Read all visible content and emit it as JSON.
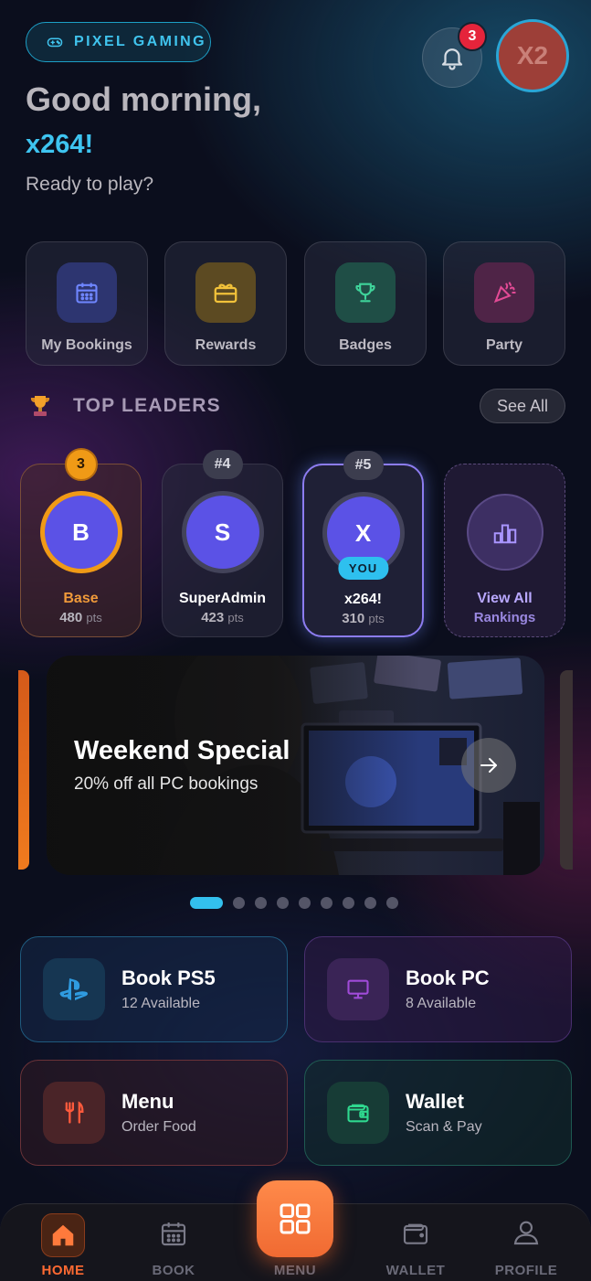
{
  "brand": {
    "label": "PIXEL GAMING",
    "accent": "#3ec4f0"
  },
  "header": {
    "notifications_count": "3",
    "avatar_initials": "X2"
  },
  "greeting": {
    "line": "Good morning,",
    "username": "x264!",
    "subtitle": "Ready to play?"
  },
  "quick_actions": [
    {
      "label": "My Bookings",
      "icon": "calendar-icon"
    },
    {
      "label": "Rewards",
      "icon": "gift-card-icon"
    },
    {
      "label": "Badges",
      "icon": "trophy-icon"
    },
    {
      "label": "Party",
      "icon": "party-popper-icon"
    }
  ],
  "leaders": {
    "title": "TOP LEADERS",
    "see_all": "See All",
    "cards": [
      {
        "rank": "3",
        "initial": "B",
        "name": "Base",
        "points": "480",
        "unit": "pts"
      },
      {
        "rank": "#4",
        "initial": "S",
        "name": "SuperAdmin",
        "points": "423",
        "unit": "pts"
      },
      {
        "rank": "#5",
        "initial": "X",
        "name": "x264!",
        "points": "310",
        "unit": "pts",
        "you_label": "YOU"
      }
    ],
    "view_all": {
      "line1": "View All",
      "line2": "Rankings"
    }
  },
  "promo": {
    "title": "Weekend Special",
    "subtitle": "20% off all PC bookings",
    "active_index": 0,
    "total_slides": 9
  },
  "actions": [
    {
      "title": "Book PS5",
      "subtitle": "12 Available",
      "icon": "playstation-icon"
    },
    {
      "title": "Book PC",
      "subtitle": "8 Available",
      "icon": "monitor-icon"
    },
    {
      "title": "Menu",
      "subtitle": "Order Food",
      "icon": "fork-knife-icon"
    },
    {
      "title": "Wallet",
      "subtitle": "Scan & Pay",
      "icon": "wallet-icon"
    }
  ],
  "nav": {
    "home": "HOME",
    "book": "BOOK",
    "menu": "MENU",
    "wallet": "WALLET",
    "profile": "PROFILE",
    "active": "home"
  }
}
